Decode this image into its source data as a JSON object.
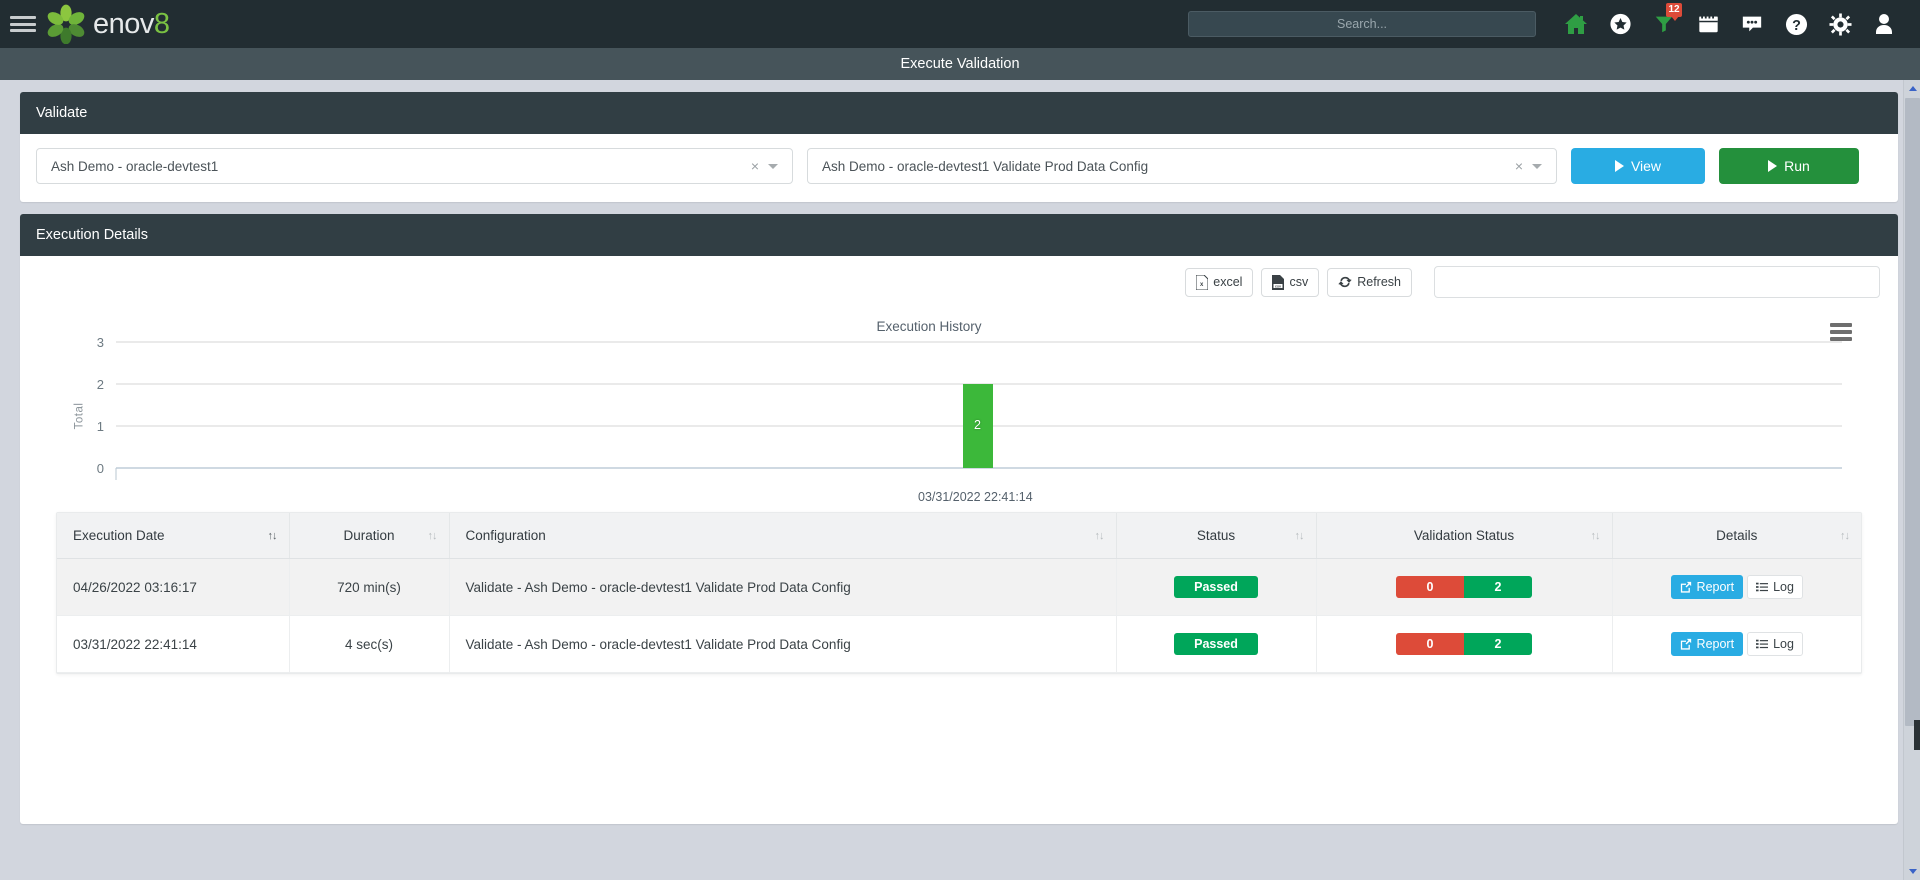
{
  "navbar": {
    "menu_icon": "hamburger-icon",
    "brand": {
      "text": "enov",
      "suffix": "8",
      "logo": "flower-logo"
    },
    "search": {
      "placeholder": "Search...",
      "value": ""
    },
    "icons": [
      {
        "name": "home-icon",
        "label": "Home"
      },
      {
        "name": "star-icon",
        "label": "Favourites"
      },
      {
        "name": "funnel-icon",
        "label": "Notifications",
        "badge": "12"
      },
      {
        "name": "calendar-icon",
        "label": "Calendar"
      },
      {
        "name": "chat-icon",
        "label": "Messages"
      },
      {
        "name": "help-icon",
        "label": "Help"
      },
      {
        "name": "gear-icon",
        "label": "Settings"
      },
      {
        "name": "user-icon",
        "label": "Profile"
      }
    ]
  },
  "page": {
    "title": "Execute Validation"
  },
  "validate_panel": {
    "title": "Validate",
    "environment_select": {
      "value": "Ash Demo - oracle-devtest1",
      "clear": "×"
    },
    "config_select": {
      "value": "Ash Demo - oracle-devtest1 Validate Prod Data Config",
      "clear": "×"
    },
    "view_button": "View",
    "run_button": "Run"
  },
  "execution_panel": {
    "title": "Execution Details",
    "toolbar": {
      "excel": "excel",
      "csv": "csv",
      "refresh": "Refresh",
      "filter": {
        "value": "",
        "placeholder": ""
      }
    }
  },
  "chart_data": {
    "type": "bar",
    "title": "Execution History",
    "xlabel": "",
    "ylabel": "Total",
    "categories": [
      "03/31/2022 22:41:14"
    ],
    "values": [
      2
    ],
    "data_labels": [
      "2"
    ],
    "ylim": [
      0,
      3
    ],
    "yticks": [
      "0",
      "1",
      "2",
      "3"
    ],
    "grid": true,
    "legend": "none",
    "bar_color": "#3cb83a",
    "menu_icon": "chart-menu-icon"
  },
  "table": {
    "columns": [
      {
        "label": "Execution Date",
        "sort": "active"
      },
      {
        "label": "Duration",
        "sort": "inactive"
      },
      {
        "label": "Configuration",
        "sort": "inactive"
      },
      {
        "label": "Status",
        "sort": "inactive"
      },
      {
        "label": "Validation Status",
        "sort": "inactive"
      },
      {
        "label": "Details",
        "sort": "inactive"
      }
    ],
    "sort_glyph": "↑↓",
    "rows": [
      {
        "date": "04/26/2022 03:16:17",
        "duration": "720 min(s)",
        "configuration": "Validate - Ash Demo - oracle-devtest1 Validate Prod Data Config",
        "status": "Passed",
        "validation_failed": "0",
        "validation_passed": "2",
        "report": "Report",
        "log": "Log"
      },
      {
        "date": "03/31/2022 22:41:14",
        "duration": "4 sec(s)",
        "configuration": "Validate - Ash Demo - oracle-devtest1 Validate Prod Data Config",
        "status": "Passed",
        "validation_failed": "0",
        "validation_passed": "2",
        "report": "Report",
        "log": "Log"
      }
    ]
  },
  "colors": {
    "navbar": "#222d32",
    "subheader": "#46545a",
    "panel_header": "#313e44",
    "page_bg": "#d2d6de",
    "accent_blue": "#29ace3",
    "accent_green": "#24903c",
    "status_green": "#00a65a",
    "status_red": "#dd4b39",
    "bar_green": "#3cb83a",
    "brand_green": "#7ac143"
  }
}
